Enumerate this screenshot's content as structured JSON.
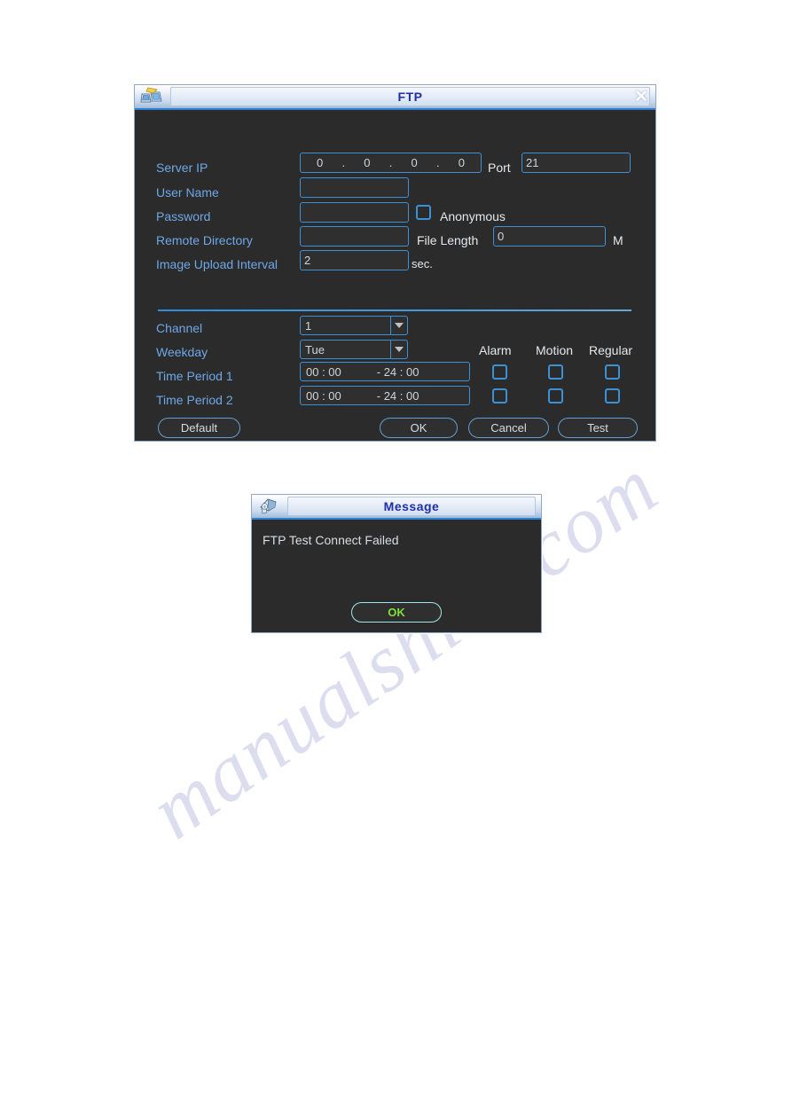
{
  "ftp_dialog": {
    "title": "FTP",
    "title_icon": "two-computers-network-icon",
    "close_label": "✕",
    "fields": {
      "server_ip_label": "Server IP",
      "server_ip_octets": [
        "0",
        "0",
        "0",
        "0"
      ],
      "port_label": "Port",
      "port_value": "21",
      "user_name_label": "User Name",
      "user_name_value": "",
      "password_label": "Password",
      "password_value": "",
      "anonymous_label": "Anonymous",
      "anonymous_checked": false,
      "remote_directory_label": "Remote Directory",
      "remote_directory_value": "",
      "file_length_label": "File Length",
      "file_length_value": "0",
      "file_length_unit": "M",
      "image_upload_interval_label": "Image Upload Interval",
      "image_upload_interval_value": "2",
      "image_upload_interval_unit": "sec."
    },
    "schedule": {
      "channel_label": "Channel",
      "channel_value": "1",
      "weekday_label": "Weekday",
      "weekday_value": "Tue",
      "column_headers": [
        "Alarm",
        "Motion",
        "Regular"
      ],
      "rows": [
        {
          "label": "Time Period 1",
          "start": "00 : 00",
          "end": "- 24 : 00",
          "alarm": false,
          "motion": false,
          "regular": false
        },
        {
          "label": "Time Period 2",
          "start": "00 : 00",
          "end": "- 24 : 00",
          "alarm": false,
          "motion": false,
          "regular": false
        }
      ]
    },
    "buttons": {
      "default": "Default",
      "ok": "OK",
      "cancel": "Cancel",
      "test": "Test"
    }
  },
  "message_dialog": {
    "title": "Message",
    "title_icon": "camera-device-icon",
    "text": "FTP Test Connect Failed",
    "ok_label": "OK"
  },
  "watermark": {
    "text": "manualshive.com"
  },
  "colors": {
    "dialog_background": "#2b2b2b",
    "accent_blue": "#3e90d6",
    "label_blue": "#6ea8e8",
    "title_blue": "#1e2fa8",
    "focus_green": "#7ee03a"
  }
}
